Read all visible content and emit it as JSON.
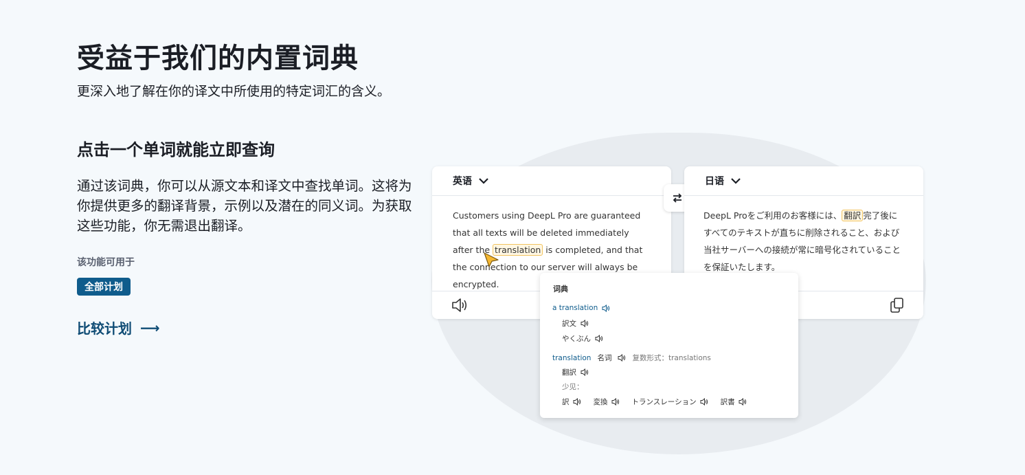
{
  "hero": {
    "title": "受益于我们的内置词典",
    "subtitle": "更深入地了解在你的译文中所使用的特定词汇的含义。"
  },
  "feature": {
    "heading": "点击一个单词就能立即查询",
    "description": "通过该词典，你可以从源文本和译文中查找单词。这将为你提供更多的翻译背景，示例以及潜在的同义词。为获取这些功能，你无需退出翻译。",
    "available_label": "该功能可用于",
    "plan_badge": "全部计划",
    "compare_link": "比较计划",
    "compare_arrow": "⟶"
  },
  "source_card": {
    "language": "英语",
    "text_before": "Customers using DeepL Pro are guaranteed that all texts will be deleted immediately after the ",
    "highlight": "translation",
    "text_after": " is completed, and that the connection to our server will always be encrypted."
  },
  "target_card": {
    "language": "日语",
    "text_before": "DeepL Proをご利用のお客様には、",
    "highlight": "翻訳",
    "text_after": "完了後にすべてのテキストが直ちに削除されること、および当社サーバーへの接続が常に暗号化されていることを保証いたします。"
  },
  "dictionary": {
    "title": "词典",
    "entry1": {
      "headword": "a translation",
      "translations": [
        "訳文",
        "やくぶん"
      ]
    },
    "entry2": {
      "headword": "translation",
      "pos": "名词",
      "plural": "复数形式：translations",
      "main": "翻訳",
      "rare_label": "少见：",
      "rare": [
        "訳",
        "変換",
        "トランスレーション",
        "訳書"
      ]
    }
  },
  "icons": {
    "speaker": "speaker-icon",
    "copy": "copy-icon",
    "swap": "swap-icon",
    "chevron": "chevron-down-icon",
    "cursor": "pointer-cursor-icon"
  },
  "colors": {
    "accent": "#0f5c8c",
    "link": "#0f4c75",
    "highlight_border": "#f1c35f",
    "cursor": "#f5b731"
  }
}
